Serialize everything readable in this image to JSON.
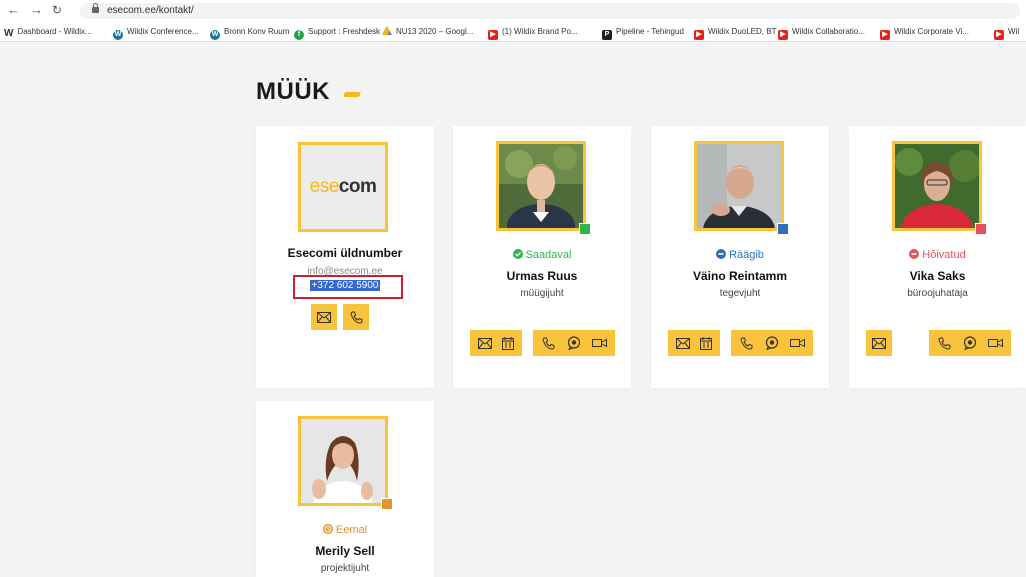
{
  "browser": {
    "url": "esecom.ee/kontakt/",
    "bookmarks": [
      {
        "label": "Dashboard - Wildix...",
        "icon": "wildix-w-icon",
        "color": "#ffffff"
      },
      {
        "label": "Wildix Conference...",
        "icon": "wordpress-icon",
        "color": "#21759b"
      },
      {
        "label": "Bronn Konv Ruum",
        "icon": "wordpress-icon",
        "color": "#21759b"
      },
      {
        "label": "Support : Freshdesk",
        "icon": "freshdesk-icon",
        "color": "#25a244"
      },
      {
        "label": "NU13 2020 – Googl...",
        "icon": "google-drive-icon",
        "color": "#f4b400"
      },
      {
        "label": "(1) Wildix Brand Po...",
        "icon": "youtube-icon",
        "color": "#e62117"
      },
      {
        "label": "Pipeline - Tehingud",
        "icon": "pipedrive-icon",
        "color": "#222222"
      },
      {
        "label": "Wildix DuoLED, BT",
        "icon": "youtube-icon",
        "color": "#e62117"
      },
      {
        "label": "Wildix Collaboratio...",
        "icon": "youtube-icon",
        "color": "#e62117"
      },
      {
        "label": "Wildix Corporate Vi...",
        "icon": "youtube-icon",
        "color": "#e62117"
      },
      {
        "label": "Wil",
        "icon": "youtube-icon",
        "color": "#e62117"
      }
    ]
  },
  "page": {
    "title": "MÜÜK",
    "accent": "#f9c33b"
  },
  "general": {
    "logo_left": "ese",
    "logo_right": "com",
    "name": "Esecomi üldnumber",
    "email": "info@esecom.ee",
    "phone": "+372 602 5900"
  },
  "people": [
    {
      "status": "Saadaval",
      "status_color": "#2db84b",
      "status_icon": "check-circle-icon",
      "name": "Urmas Ruus",
      "role": "müügijuht"
    },
    {
      "status": "Räägib",
      "status_color": "#2f6fba",
      "status_icon": "minus-circle-icon",
      "name": "Väino Reintamm",
      "role": "tegevjuht"
    },
    {
      "status": "Hõivatud",
      "status_color": "#e4505e",
      "status_icon": "minus-circle-icon",
      "name": "Vika Saks",
      "role": "büroojuhataja"
    },
    {
      "status": "Eemal",
      "status_color": "#e0962b",
      "status_icon": "clock-icon",
      "name": "Merily Sell",
      "role": "projektijuht"
    }
  ]
}
